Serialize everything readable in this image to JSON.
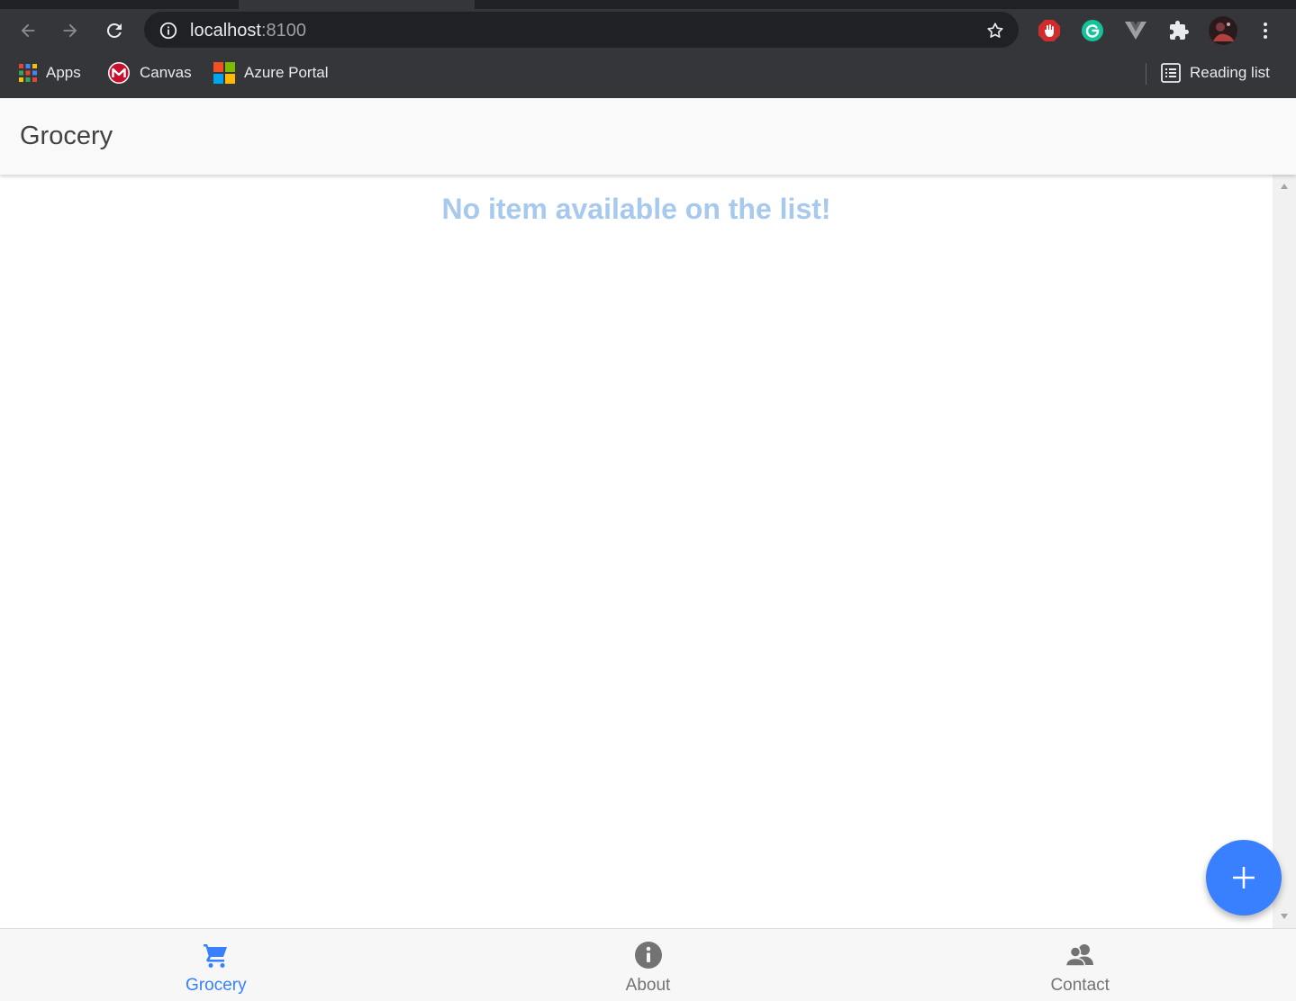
{
  "browser": {
    "url_host": "localhost",
    "url_port": ":8100",
    "bookmarks": [
      {
        "label": "Apps"
      },
      {
        "label": "Canvas"
      },
      {
        "label": "Azure Portal"
      }
    ],
    "reading_list_label": "Reading list"
  },
  "app": {
    "title": "Grocery",
    "empty_message": "No item available on the list!",
    "accent_color": "#3880ff",
    "tabs": [
      {
        "label": "Grocery",
        "icon": "cart-icon",
        "active": true
      },
      {
        "label": "About",
        "icon": "info-circle-icon",
        "active": false
      },
      {
        "label": "Contact",
        "icon": "people-icon",
        "active": false
      }
    ],
    "fab_icon": "plus-icon"
  }
}
